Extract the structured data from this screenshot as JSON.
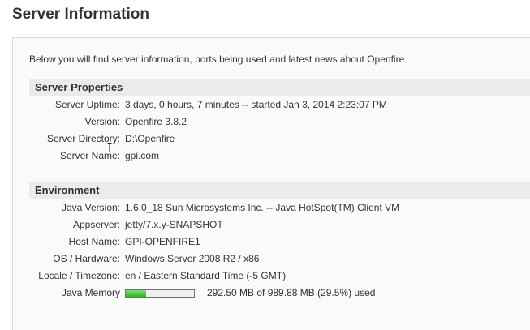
{
  "page": {
    "title": "Server Information",
    "intro": "Below you will find server information, ports being used and latest news about Openfire."
  },
  "server_properties": {
    "header": "Server Properties",
    "rows": [
      {
        "label": "Server Uptime:",
        "value": "3 days, 0 hours, 7 minutes -- started Jan 3, 2014 2:23:07 PM"
      },
      {
        "label": "Version:",
        "value": "Openfire 3.8.2"
      },
      {
        "label": "Server Directory:",
        "value": "D:\\Openfire"
      },
      {
        "label": "Server Name:",
        "value": "gpi.com"
      }
    ]
  },
  "environment": {
    "header": "Environment",
    "rows": [
      {
        "label": "Java Version:",
        "value": "1.6.0_18 Sun Microsystems Inc. -- Java HotSpot(TM) Client VM"
      },
      {
        "label": "Appserver:",
        "value": "jetty/7.x.y-SNAPSHOT"
      },
      {
        "label": "Host Name:",
        "value": "GPI-OPENFIRE1"
      },
      {
        "label": "OS / Hardware:",
        "value": "Windows Server 2008 R2 / x86"
      },
      {
        "label": "Locale / Timezone:",
        "value": "en / Eastern Standard Time (-5 GMT)"
      }
    ],
    "memory": {
      "label": "Java Memory",
      "text": "292.50 MB of 989.88 MB (29.5%) used",
      "percent_used": 29.5,
      "fill_color": "#3cbf3c"
    }
  },
  "icons": {
    "cursor": "text-cursor-icon"
  }
}
